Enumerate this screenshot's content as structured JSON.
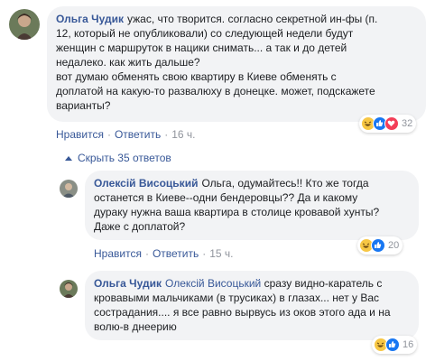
{
  "comments": [
    {
      "author": "Ольга Чудик",
      "text_lines": [
        "ужас, что творится. согласно секретной ин-фы (п.",
        "12, который не опубликовали) со следующей недели будут",
        "женщин с маршруток в нацики снимать... а так и до детей",
        "недалеко. как жить дальше?",
        "вот думаю обменять свою квартиру в Киеве обменять с",
        "доплатой на какую-то развалюху в донецке. может, подскажете",
        "варианты?"
      ],
      "reaction_count": "32",
      "like_label": "Нравится",
      "reply_label": "Ответить",
      "time": "16 ч."
    }
  ],
  "toggle_replies": "Скрыть 35 ответов",
  "replies": [
    {
      "author": "Олексій Висоцький",
      "text_lines": [
        "Ольга, одумайтесь!! Кто же тогда",
        "останется в Киеве--одни бендеровцы?? Да и какому",
        "дураку нужна ваша квартира в столице кровавой хунты?",
        "Даже с доплатой?"
      ],
      "reaction_count": "20",
      "like_label": "Нравится",
      "reply_label": "Ответить",
      "time": "15 ч."
    },
    {
      "author": "Ольга Чудик",
      "mention": "Олексій Висоцький",
      "text_lines": [
        "сразу видно-каратель с",
        "кровавыми мальчиками (в трусиках) в глазах... нет у Вас",
        "сострадания.... я все равно вырвусь из оков этого ада и на",
        "волю-в днеерию"
      ],
      "reaction_count": "16"
    }
  ],
  "colors": {
    "link": "#385898",
    "bubble": "#f2f3f5",
    "meta": "#90949c"
  },
  "icons": [
    "haha-icon",
    "like-icon",
    "love-icon"
  ]
}
